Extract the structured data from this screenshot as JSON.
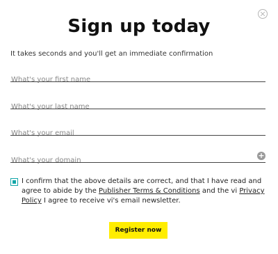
{
  "modal": {
    "title": "Sign up today",
    "subtitle": "It takes seconds and you'll get an immediate confirmation"
  },
  "fields": {
    "first_name": {
      "placeholder": "What's your first name",
      "value": ""
    },
    "last_name": {
      "placeholder": "What's your last name",
      "value": ""
    },
    "email": {
      "placeholder": "What's your email",
      "value": ""
    },
    "domain": {
      "placeholder": "What's your domain",
      "value": "",
      "info_icon": "plus-circle-icon"
    }
  },
  "consent": {
    "checked": true,
    "text_before": "I confirm that the above details are correct, and that I have read and agree to abide by the ",
    "terms_link": "Publisher Terms & Conditions",
    "text_middle": " and the vi ",
    "privacy_link": "Privacy Policy",
    "text_after": " I agree to receive vi's email newsletter."
  },
  "actions": {
    "register_label": "Register now",
    "close_icon": "close-icon"
  },
  "colors": {
    "accent_button": "#ffed00",
    "checkbox": "#12a6a8"
  }
}
